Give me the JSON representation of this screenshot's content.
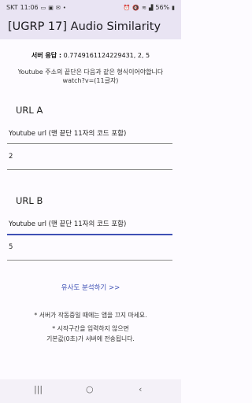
{
  "status_bar": {
    "carrier": "SKT",
    "time": "11:06",
    "battery": "56%",
    "icons": [
      "message-icon",
      "gallery-icon",
      "mail-icon",
      "dot-icon",
      "alarm-icon",
      "mute-icon",
      "wifi-icon",
      "signal-icon",
      "battery-icon"
    ]
  },
  "app_bar": {
    "title": "[UGRP 17] Audio Similarity"
  },
  "response": {
    "label": "서버 응답 :",
    "value": "0.7749161124229431, 2, 5"
  },
  "notice": "Youtube 주소의 끝단은 다음과 같은 형식이어야합니다 watch?v=(11글자)",
  "url_a": {
    "title": "URL A",
    "label": "Youtube url (맨 끝단 11자의 코드 포함)",
    "start_value": "2"
  },
  "url_b": {
    "title": "URL B",
    "label": "Youtube url (맨 끝단 11자의 코드 포함)",
    "start_value": "5"
  },
  "analyze_button": "유사도 분석하기 >>",
  "notes": {
    "line1": "* 서버가 작동중일 때에는 앱을 끄지 마세요.",
    "line2": "* 시작구간을 입력하지 않으면",
    "line3": "기본값(0초)가 서버에 전송됩니다."
  },
  "nav_bar": {
    "recents": "|||",
    "home": "○",
    "back": "‹"
  }
}
